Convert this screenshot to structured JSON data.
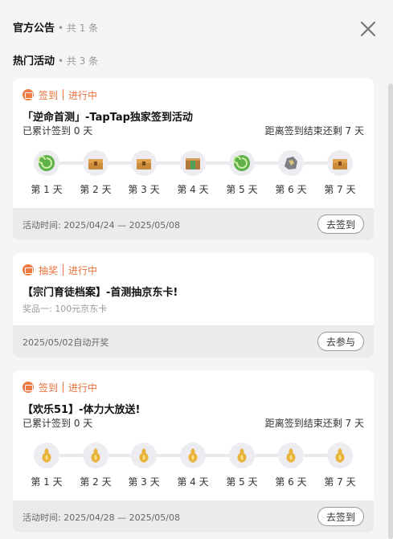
{
  "header": {
    "official_title": "官方公告",
    "official_count": "• 共 1 条",
    "hot_title": "热门活动",
    "hot_count": "• 共 3 条"
  },
  "cards": [
    {
      "tag": "签到",
      "status": "进行中",
      "title": "「逆命首测」-TapTap独家签到活动",
      "accumulated": "已累计签到 0 天",
      "remaining": "距离签到结束还剩 7 天",
      "days": [
        "第 1 天",
        "第 2 天",
        "第 3 天",
        "第 4 天",
        "第 5 天",
        "第 6 天",
        "第 7 天"
      ],
      "rewards": [
        "green-swirl-icon",
        "treasure-chest-icon",
        "treasure-chest-icon",
        "supply-box-icon",
        "green-swirl-icon",
        "ore-stone-icon",
        "treasure-chest-icon"
      ],
      "footer": "活动时间: 2025/04/24 — 2025/05/08",
      "button": "去签到"
    },
    {
      "tag": "抽奖",
      "status": "进行中",
      "title": "【宗门育徒档案】-首测抽京东卡!",
      "prize": "奖品一: 100元京东卡",
      "footer": "2025/05/02自动开奖",
      "button": "去参与"
    },
    {
      "tag": "签到",
      "status": "进行中",
      "title": "【欢乐51】-体力大放送!",
      "accumulated": "已累计签到 0 天",
      "remaining": "距离签到结束还剩 7 天",
      "days": [
        "第 1 天",
        "第 2 天",
        "第 3 天",
        "第 4 天",
        "第 5 天",
        "第 6 天",
        "第 7 天"
      ],
      "rewards": [
        "stamina-gourd-icon",
        "stamina-gourd-icon",
        "stamina-gourd-icon",
        "stamina-gourd-icon",
        "stamina-gourd-icon",
        "stamina-gourd-icon",
        "stamina-gourd-icon"
      ],
      "footer": "活动时间: 2025/04/28 — 2025/05/08",
      "button": "去签到"
    }
  ],
  "colors": {
    "accent": "#e8703a",
    "card_bg": "#ffffff",
    "footer_bg": "#ebebed",
    "page_bg": "#f5f5f5"
  }
}
